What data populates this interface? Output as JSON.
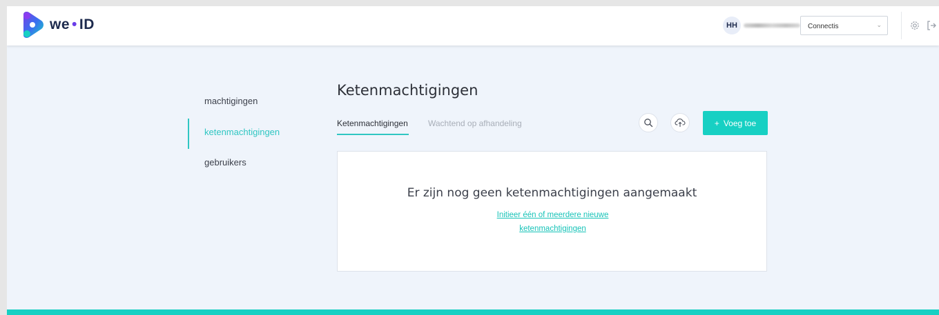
{
  "header": {
    "logo_text": "we",
    "logo_dot": "•",
    "logo_suffix": "ID",
    "user_initials": "HH",
    "org_select_value": "Connectis"
  },
  "sidebar": {
    "items": [
      {
        "label": "machtigingen",
        "active": false
      },
      {
        "label": "ketenmachtigingen",
        "active": true
      },
      {
        "label": "gebruikers",
        "active": false
      }
    ]
  },
  "main": {
    "title": "Ketenmachtigingen",
    "tabs": [
      {
        "label": "Ketenmachtigingen",
        "active": true
      },
      {
        "label": "Wachtend op afhandeling",
        "active": false
      }
    ],
    "add_button_plus": "+",
    "add_button_label": "Voeg toe",
    "empty_title": "Er zijn nog geen ketenmachtigingen aangemaakt",
    "empty_link": "Initieer één of meerdere nieuwe ketenmachtigingen"
  },
  "colors": {
    "accent": "#17d0c3",
    "background": "#eff4fb",
    "text": "#2d3038"
  },
  "icons": {
    "search": "search-icon",
    "upload": "cloud-upload-icon",
    "settings": "gear-icon",
    "logout": "logout-icon"
  }
}
